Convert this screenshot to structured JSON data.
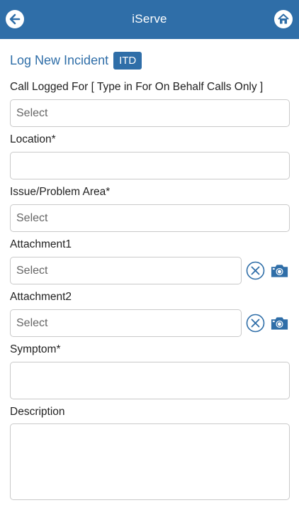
{
  "app": {
    "title": "iServe"
  },
  "header": {
    "heading": "Log New Incident",
    "badge": "ITD"
  },
  "form": {
    "call_logged_for": {
      "label": "Call Logged For [ Type in For On Behalf Calls Only ]",
      "value": "Select"
    },
    "location": {
      "label": "Location*",
      "value": ""
    },
    "issue_area": {
      "label": "Issue/Problem Area*",
      "value": "Select"
    },
    "attachment1": {
      "label": "Attachment1",
      "value": "Select"
    },
    "attachment2": {
      "label": "Attachment2",
      "value": "Select"
    },
    "symptom": {
      "label": "Symptom*",
      "value": ""
    },
    "description": {
      "label": "Description",
      "value": ""
    }
  },
  "icons": {
    "back": "arrow-left-circle-icon",
    "home": "home-icon",
    "clear": "x-circle-icon",
    "camera": "camera-icon"
  },
  "colors": {
    "primary": "#2f6ea8",
    "border": "#c9c9c9"
  }
}
